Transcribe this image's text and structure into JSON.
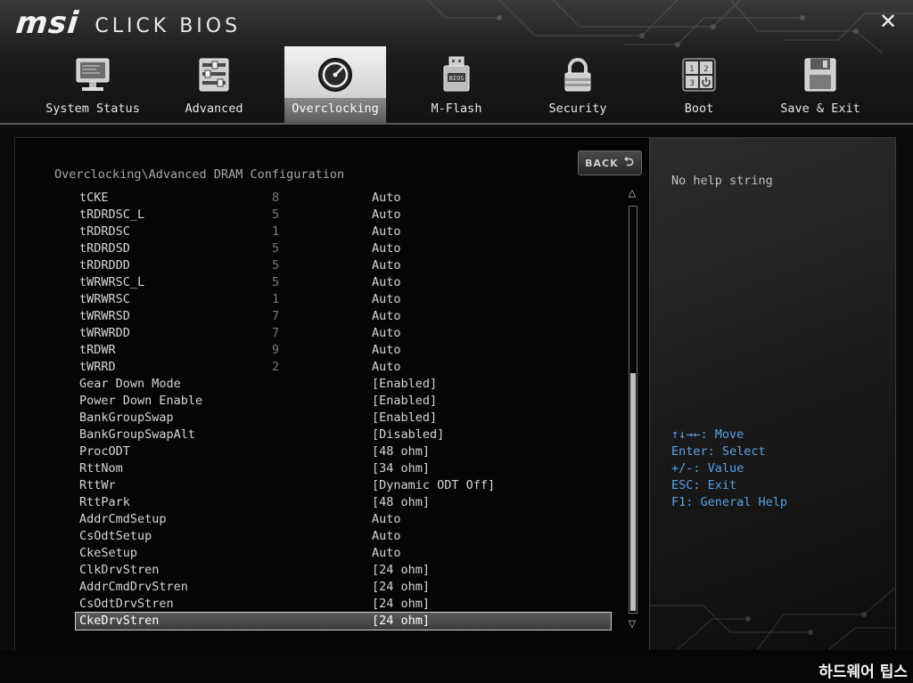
{
  "window": {
    "brand": "msi",
    "product": "CLICK BIOS"
  },
  "tabs": [
    {
      "label": "System Status",
      "icon": "monitor-icon"
    },
    {
      "label": "Advanced",
      "icon": "sliders-icon"
    },
    {
      "label": "Overclocking",
      "icon": "speedometer-icon",
      "active": true
    },
    {
      "label": "M-Flash",
      "icon": "usb-drive-icon"
    },
    {
      "label": "Security",
      "icon": "padlock-icon"
    },
    {
      "label": "Boot",
      "icon": "boot-order-icon"
    },
    {
      "label": "Save & Exit",
      "icon": "floppy-disk-icon"
    }
  ],
  "main": {
    "breadcrumb": "Overclocking\\Advanced DRAM Configuration",
    "back_label": "BACK",
    "rows": [
      {
        "name": "tCKE",
        "current": "8",
        "value": "Auto"
      },
      {
        "name": "tRDRDSC_L",
        "current": "5",
        "value": "Auto"
      },
      {
        "name": "tRDRDSC",
        "current": "1",
        "value": "Auto"
      },
      {
        "name": "tRDRDSD",
        "current": "5",
        "value": "Auto"
      },
      {
        "name": "tRDRDDD",
        "current": "5",
        "value": "Auto"
      },
      {
        "name": "tWRWRSC_L",
        "current": "5",
        "value": "Auto"
      },
      {
        "name": "tWRWRSC",
        "current": "1",
        "value": "Auto"
      },
      {
        "name": "tWRWRSD",
        "current": "7",
        "value": "Auto"
      },
      {
        "name": "tWRWRDD",
        "current": "7",
        "value": "Auto"
      },
      {
        "name": "tRDWR",
        "current": "9",
        "value": "Auto"
      },
      {
        "name": "tWRRD",
        "current": "2",
        "value": "Auto"
      },
      {
        "name": "Gear Down Mode",
        "current": "",
        "value": "[Enabled]"
      },
      {
        "name": "Power Down Enable",
        "current": "",
        "value": "[Enabled]"
      },
      {
        "name": "BankGroupSwap",
        "current": "",
        "value": "[Enabled]"
      },
      {
        "name": "BankGroupSwapAlt",
        "current": "",
        "value": "[Disabled]"
      },
      {
        "name": "ProcODT",
        "current": "",
        "value": "[48 ohm]"
      },
      {
        "name": "RttNom",
        "current": "",
        "value": "[34 ohm]"
      },
      {
        "name": "RttWr",
        "current": "",
        "value": "[Dynamic ODT Off]"
      },
      {
        "name": "RttPark",
        "current": "",
        "value": "[48 ohm]"
      },
      {
        "name": "AddrCmdSetup",
        "current": "",
        "value": "Auto"
      },
      {
        "name": "CsOdtSetup",
        "current": "",
        "value": "Auto"
      },
      {
        "name": "CkeSetup",
        "current": "",
        "value": "Auto"
      },
      {
        "name": "ClkDrvStren",
        "current": "",
        "value": "[24 ohm]"
      },
      {
        "name": "AddrCmdDrvStren",
        "current": "",
        "value": "[24 ohm]"
      },
      {
        "name": "CsOdtDrvStren",
        "current": "",
        "value": "[24 ohm]"
      },
      {
        "name": "CkeDrvStren",
        "current": "",
        "value": "[24 ohm]",
        "selected": true
      }
    ],
    "scroll": {
      "thumb_start": 0.41,
      "thumb_end": 1.0
    }
  },
  "help": {
    "text": "No help string",
    "keys": [
      "↑↓→←: Move",
      "Enter: Select",
      "+/-: Value",
      "ESC: Exit",
      "F1: General Help"
    ]
  },
  "watermark": "하드웨어 팁스",
  "colors": {
    "accent_blue": "#5aa0e6",
    "selected_row": "#4a4a4a",
    "tab_active": "#d9d9d9"
  }
}
